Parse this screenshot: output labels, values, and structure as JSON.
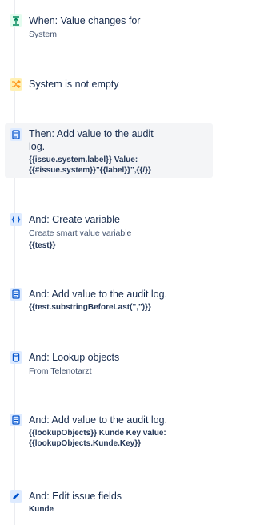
{
  "colors": {
    "trigger": "#00875a",
    "condition": "#ff991f",
    "action": "#0052cc",
    "rail": "#ebecf0"
  },
  "steps": [
    {
      "icon": "trigger-icon",
      "title": "When: Value changes for",
      "subtitle": "System"
    },
    {
      "icon": "condition-icon",
      "title": "System is not empty"
    },
    {
      "icon": "log-icon",
      "title": "Then: Add value to the audit log.",
      "code": [
        "{{issue.system.label}} Value:",
        "{{#issue.system}}\"{{label}}\",{{/}}"
      ]
    },
    {
      "icon": "variable-icon",
      "title": "And: Create variable",
      "subtitle": "Create smart value variable",
      "code": [
        "{{test}}"
      ]
    },
    {
      "icon": "log-icon",
      "title": "And: Add value to the audit log.",
      "code": [
        "{{test.substringBeforeLast(\",\")}}"
      ]
    },
    {
      "icon": "lookup-icon",
      "title": "And: Lookup objects",
      "subtitle": "From Telenotarzt"
    },
    {
      "icon": "log-icon",
      "title": "And: Add value to the audit log.",
      "code": [
        "{{lookupObjects}} Kunde Key value:",
        "{{lookupObjects.Kunde.Key}}"
      ]
    },
    {
      "icon": "edit-icon",
      "title": "And: Edit issue fields",
      "code": [
        "Kunde"
      ]
    }
  ]
}
